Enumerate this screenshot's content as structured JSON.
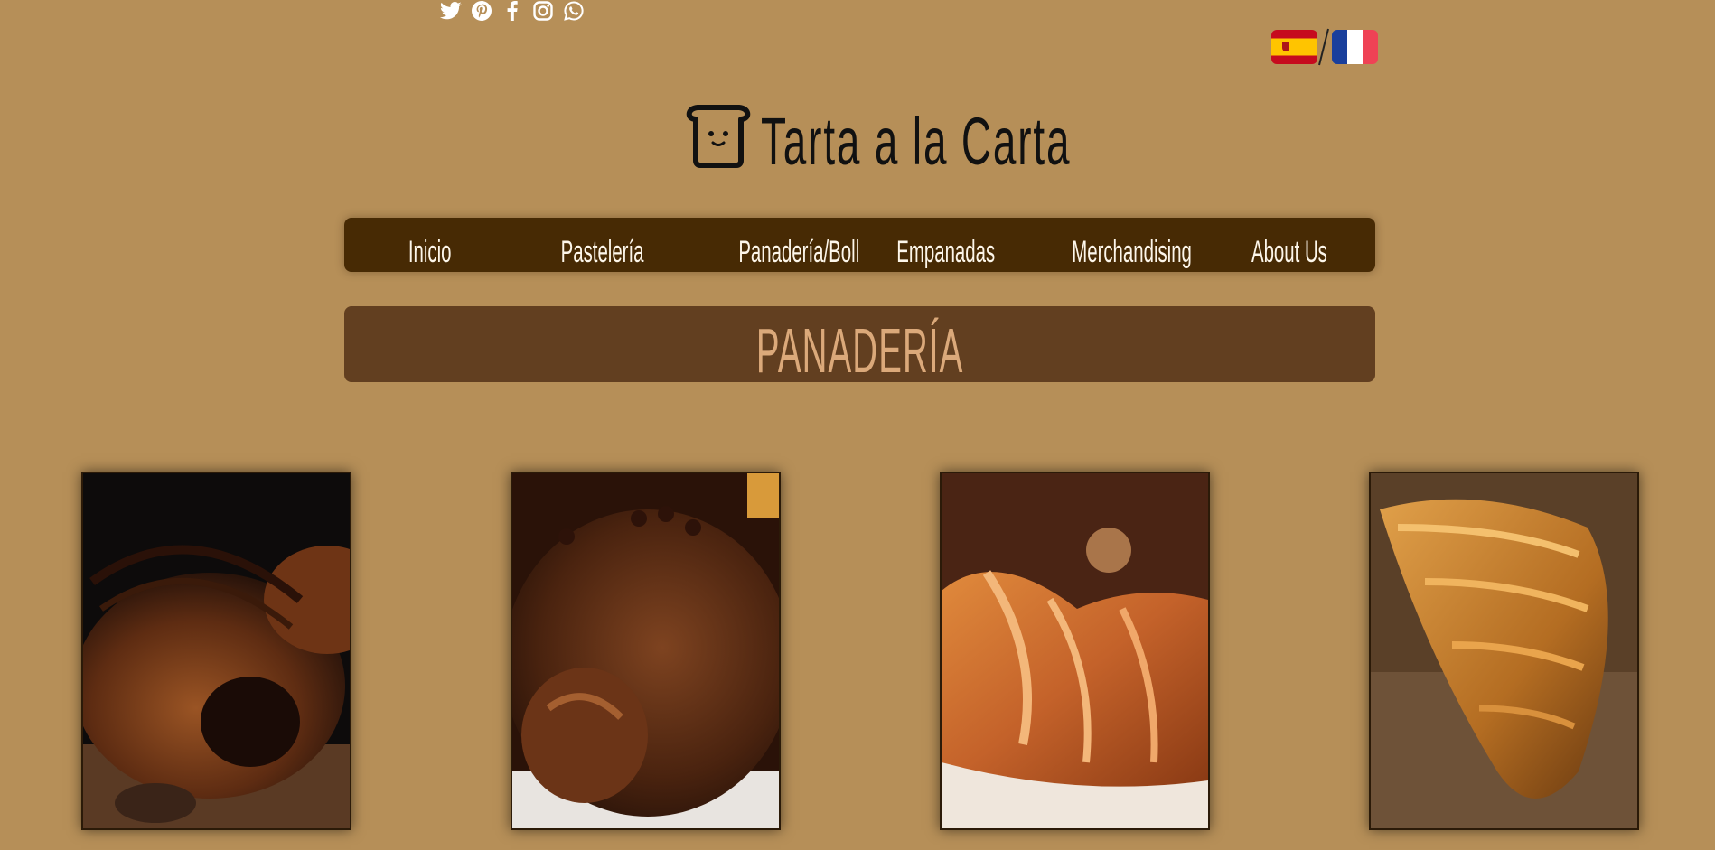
{
  "social": {
    "icons": [
      "twitter-icon",
      "pinterest-icon",
      "facebook-icon",
      "instagram-icon",
      "whatsapp-icon"
    ],
    "icon_color": "#ffffff"
  },
  "languages": {
    "items": [
      "spain-flag",
      "france-flag"
    ],
    "separator": "/"
  },
  "brand": {
    "title": "Tarta a la Carta",
    "logo_icon": "toast-icon"
  },
  "nav": {
    "items": [
      {
        "label": "Inicio"
      },
      {
        "label": "Pastelería"
      },
      {
        "label": "Panadería/Bollería"
      },
      {
        "label": "Empanadas"
      },
      {
        "label": "Merchandising"
      },
      {
        "label": "About Us"
      }
    ]
  },
  "section": {
    "title": "PANADERÍA"
  },
  "products": [
    {
      "image": "chocolate-croissant-photo"
    },
    {
      "image": "chocolate-glazed-croissant-photo"
    },
    {
      "image": "butter-croissant-photo"
    },
    {
      "image": "golden-croissant-photo"
    }
  ],
  "colors": {
    "background": "#b68f58",
    "nav_bg": "#472a04",
    "section_bg": "#623f20",
    "section_text": "#dba97a",
    "nav_text": "#fdf6ea"
  }
}
